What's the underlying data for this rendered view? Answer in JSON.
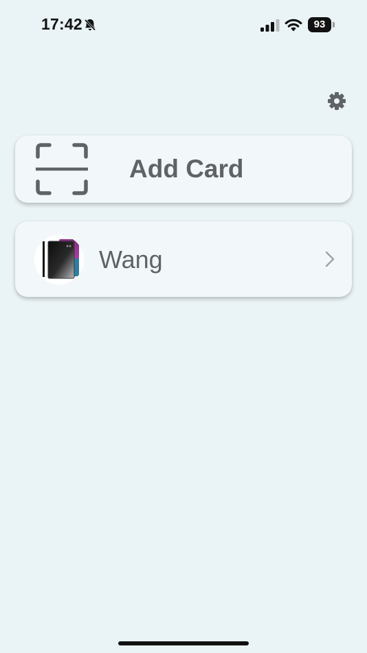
{
  "status_bar": {
    "time": "17:42",
    "battery": "93",
    "icons": [
      "bell-slash-icon",
      "cellular-signal-icon",
      "wifi-icon",
      "battery-icon"
    ]
  },
  "header": {
    "settings_icon": "gear-icon"
  },
  "add_card": {
    "icon": "scan-frame-icon",
    "label": "Add Card"
  },
  "cards": [
    {
      "name": "Wang",
      "thumbnail": "card-stack-thumbnail",
      "chevron": "chevron-right-icon"
    }
  ],
  "colors": {
    "background": "#eaf3f5",
    "card_background": "#f2f8f9",
    "text": "#5f6366",
    "icon": "#5f6366"
  }
}
